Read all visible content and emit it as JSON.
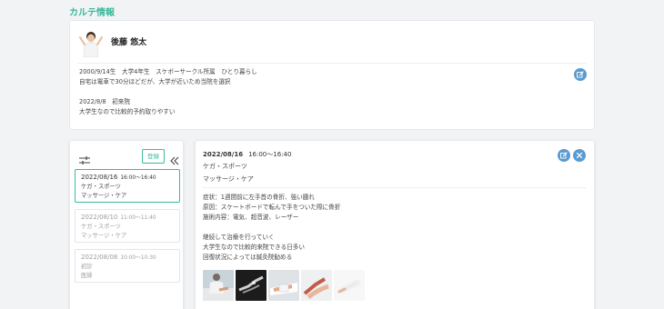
{
  "page": {
    "title": "カルテ情報"
  },
  "patient": {
    "name": "後藤 悠太",
    "notes": [
      "2000/9/14生　大学4年生　スケボーサークル所属　ひとり暮らし",
      "自宅は電車で30分ほどだが、大学が近いため当院を選択",
      "",
      "2022/8/8　初来院",
      "大学生なので比較的予約取りやすい"
    ]
  },
  "visit_list": {
    "register_label": "登録",
    "items": [
      {
        "date": "2022/08/16",
        "time": "16:00〜16:40",
        "lines": [
          "ケガ・スポーツ",
          "マッサージ・ケア"
        ]
      },
      {
        "date": "2022/08/10",
        "time": "11:00〜11:40",
        "lines": [
          "ケガ・スポーツ",
          "マッサージ・ケア"
        ]
      },
      {
        "date": "2022/08/08",
        "time": "10:00〜10:30",
        "lines": [
          "初診",
          "医師"
        ]
      }
    ]
  },
  "detail": {
    "date": "2022/08/16",
    "time": "16:00〜16:40",
    "line1": "ケガ・スポーツ",
    "line2": "マッサージ・ケア",
    "notes": [
      "症状：1週間前に左手首の骨折、強い腫れ",
      "原因：スケートボードで転んで手をついた際に骨折",
      "施術内容：電気、超音波、レーザー",
      "",
      "継続して治療を行っていく",
      "大学生なので比較的来院できる日多い",
      "回復状況によっては鍼灸院勧める"
    ]
  },
  "icons": {
    "edit": "edit-icon",
    "delete": "close-icon",
    "filter": "sliders-icon",
    "collapse": "double-chevron-left-icon"
  },
  "colors": {
    "accent": "#3bb89a",
    "icon_button": "#5b9bcf"
  }
}
